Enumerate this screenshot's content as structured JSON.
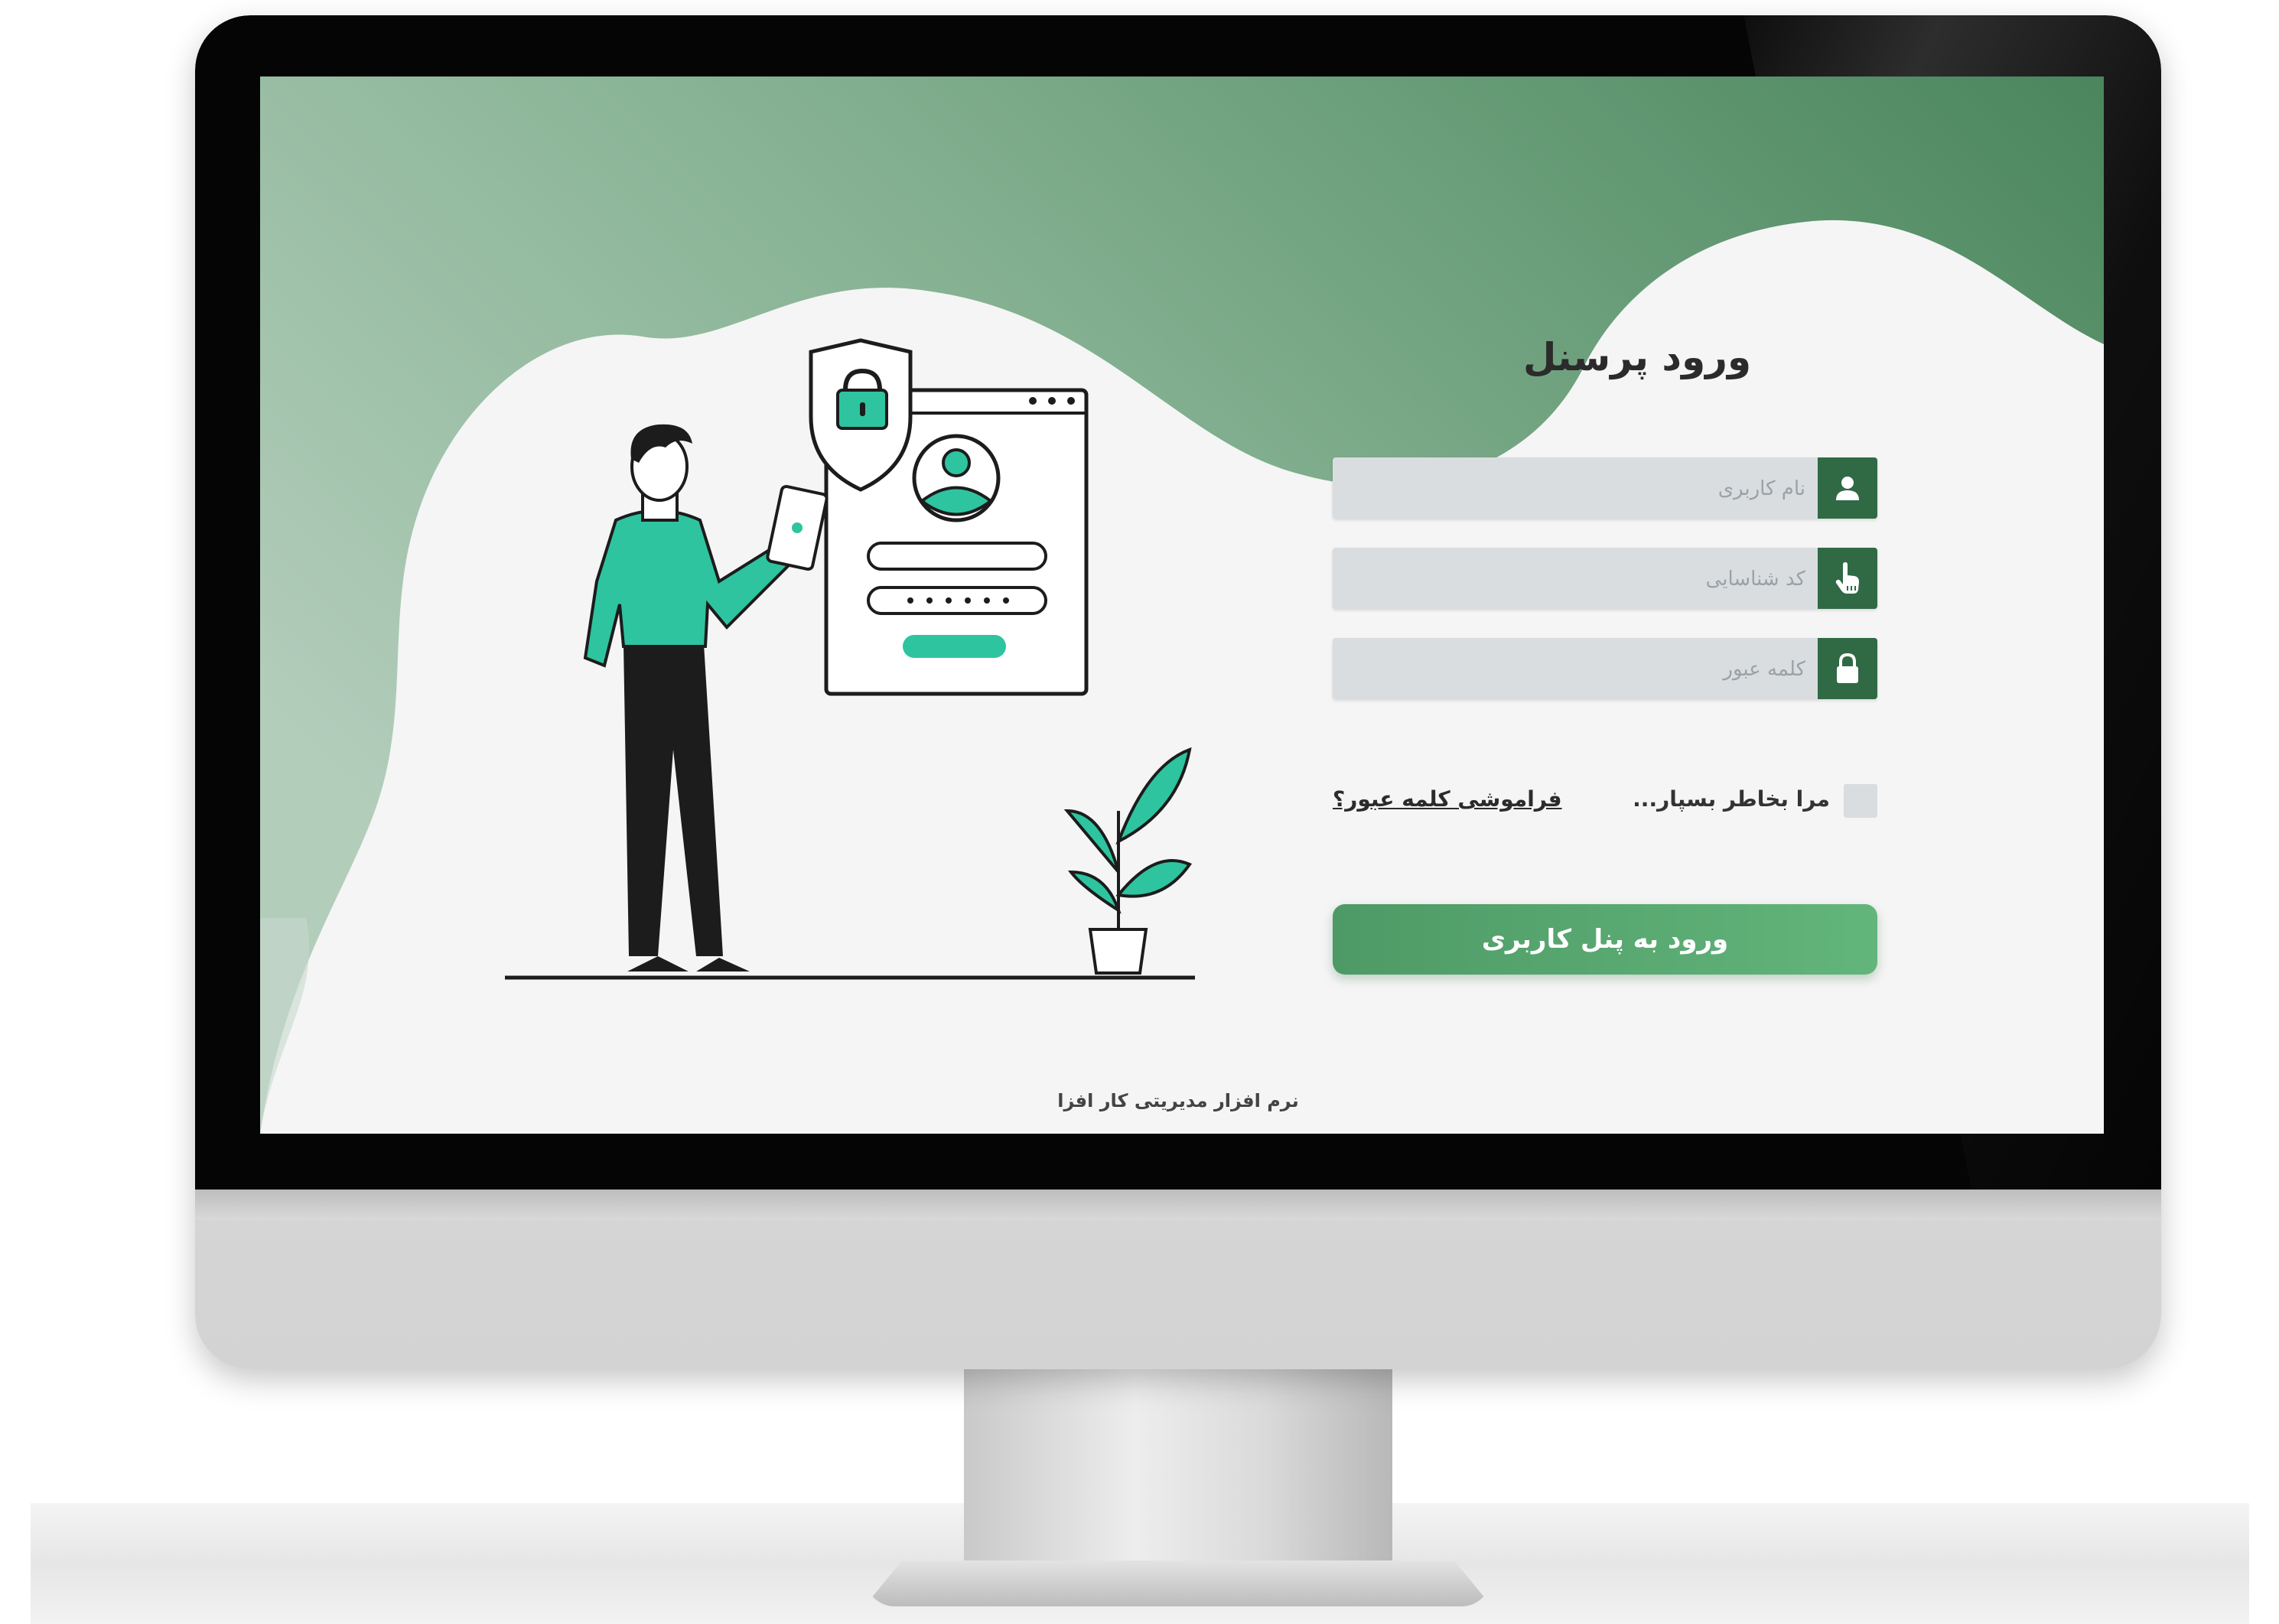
{
  "login": {
    "title": "ورود پرسنل",
    "username_placeholder": "نام کاربری",
    "id_code_placeholder": "کد شناسایی",
    "password_placeholder": "کلمه عبور",
    "remember_label": "مرا بخاطر بسپار...",
    "forgot_link": "فراموشی کلمه عبور؟",
    "submit_label": "ورود به پنل کاربری",
    "remember_checked": false
  },
  "footer": {
    "text": "نرم افزار مدیریتی کار افزا"
  },
  "icons": {
    "username": "user-icon",
    "id_code": "hand-pointer-icon",
    "password": "lock-icon",
    "illustration": [
      "shield-lock-icon",
      "profile-window-icon",
      "plant-icon"
    ]
  },
  "colors": {
    "accent_dark_green": "#2f6a45",
    "button_green": "#5aa873",
    "illustration_teal": "#2ec4a0",
    "field_gray": "#d9dde0",
    "background_light": "#f5f5f5"
  }
}
